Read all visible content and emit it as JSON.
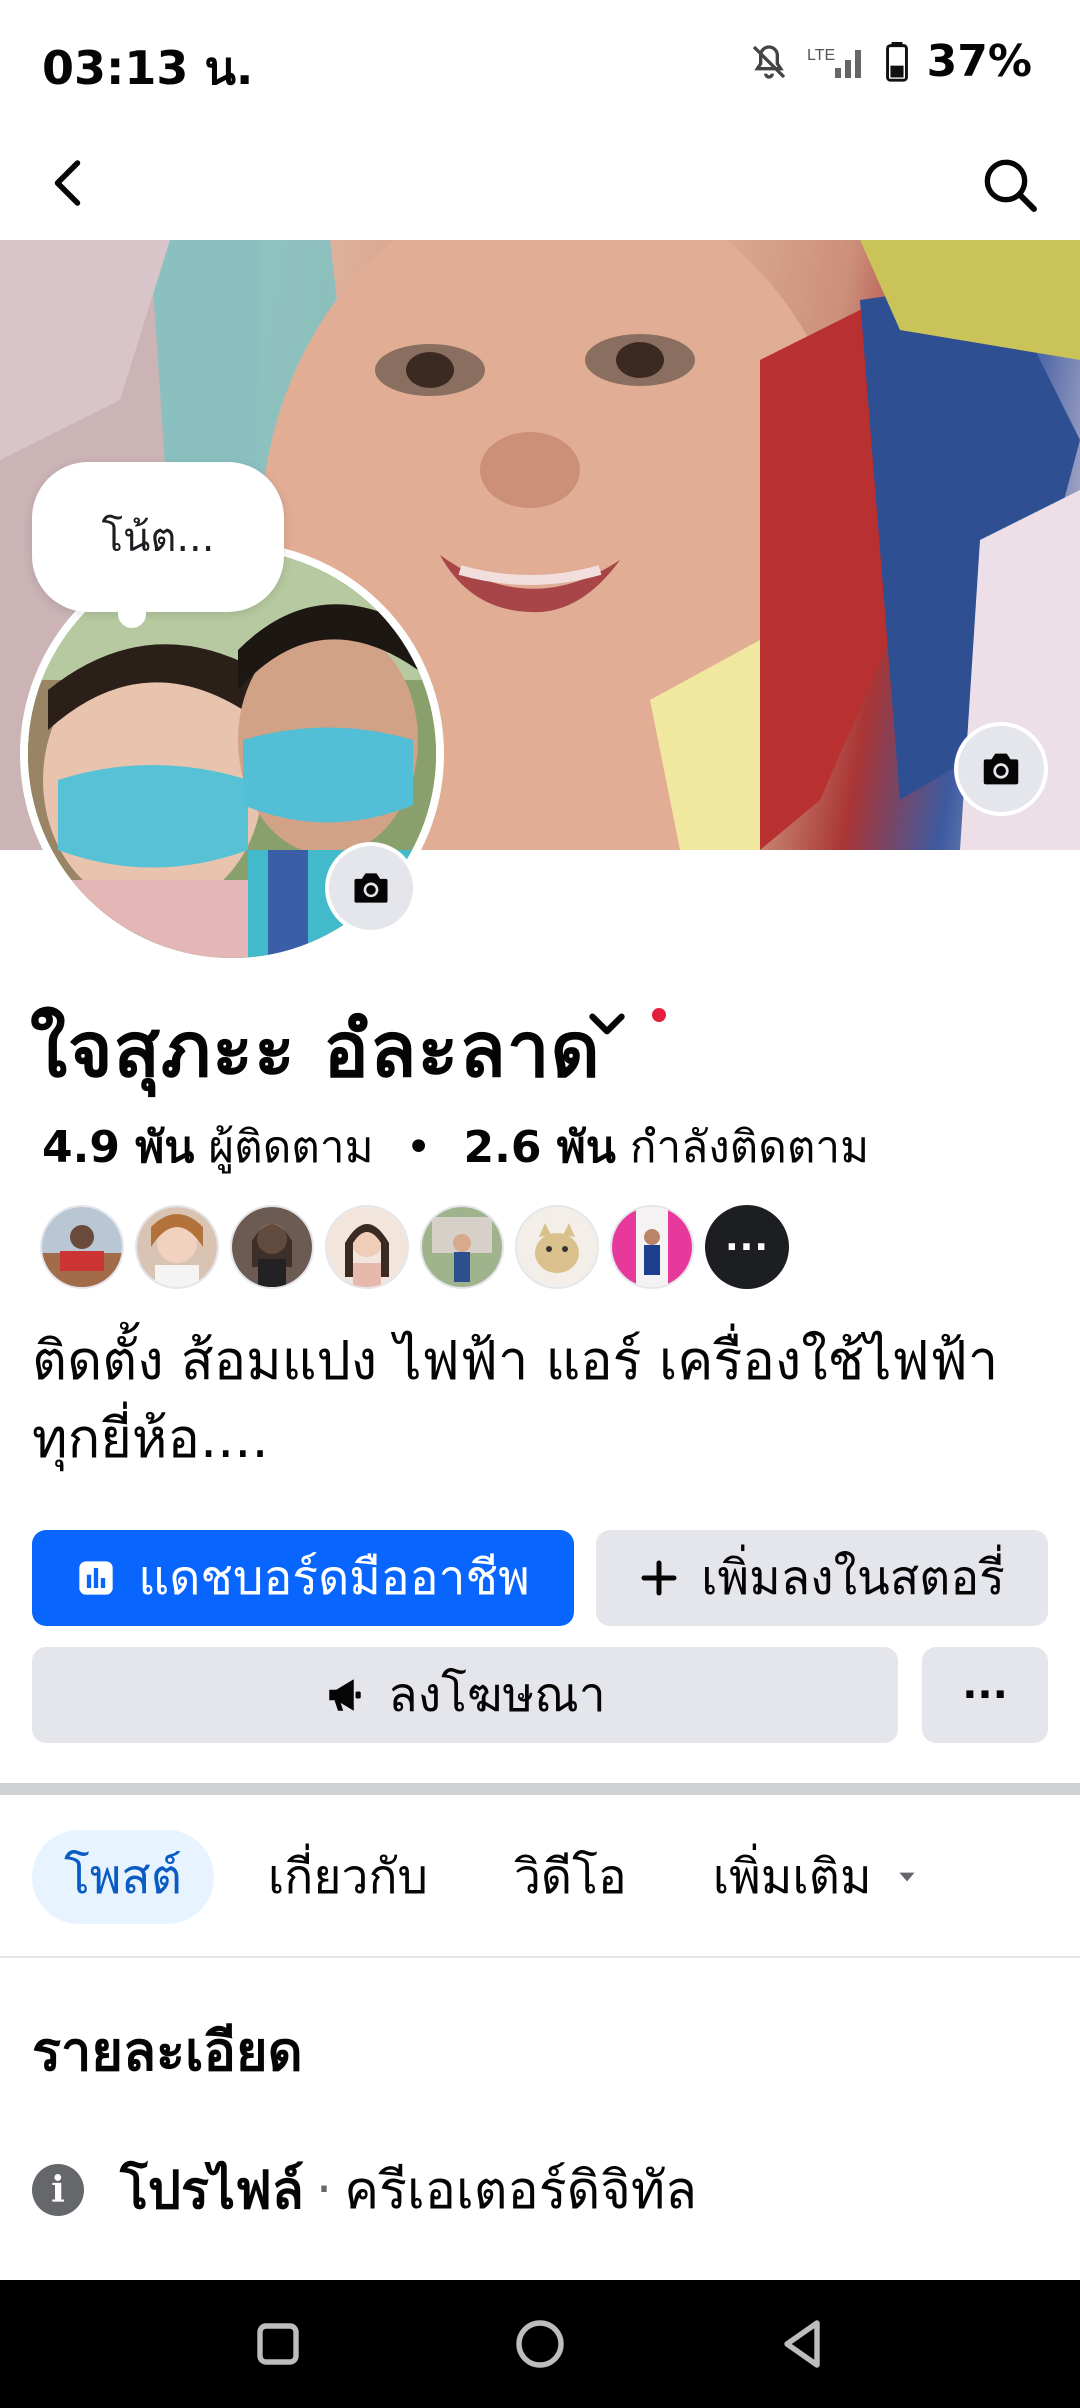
{
  "status_bar": {
    "time": "03:13 น.",
    "battery": "37%",
    "icons": [
      "mute-icon",
      "signal-icon",
      "battery-icon"
    ]
  },
  "profile": {
    "note": "โน้ต...",
    "name": "ใจสุภะะ อํละลาด",
    "followers_count": "4.9 พัน",
    "followers_label": "ผู้ติดตาม",
    "following_count": "2.6 พัน",
    "following_label": "กำลังติดตาม",
    "bio": "ติดตั้ง ส้อมแปง ไฟฟ้า แอร์ เครื่องใช้ไฟฟ้า ทุกยี่ห้อ...."
  },
  "actions": {
    "dashboard": "แดชบอร์ดมืออาชีพ",
    "add_story": "เพิ่มลงในสตอรี่",
    "advertise": "ลงโฆษณา",
    "more": "···"
  },
  "tabs": [
    {
      "label": "โพสต์",
      "active": true
    },
    {
      "label": "เกี่ยวกับ",
      "active": false
    },
    {
      "label": "วิดีโอ",
      "active": false
    },
    {
      "label": "เพิ่มเติม",
      "active": false
    }
  ],
  "details": {
    "title": "รายละเอียด",
    "profile_label": "โปรไฟล์",
    "separator": "·",
    "profile_value": "ครีเอเตอร์ดิจิทัล"
  },
  "followers_more": "···",
  "colors": {
    "primary": "#0866ff",
    "secondary_button": "#e4e6eb",
    "active_tab_bg": "#e7f3ff",
    "active_tab_text": "#0a5cc2",
    "notification_dot": "#e41e3f"
  }
}
